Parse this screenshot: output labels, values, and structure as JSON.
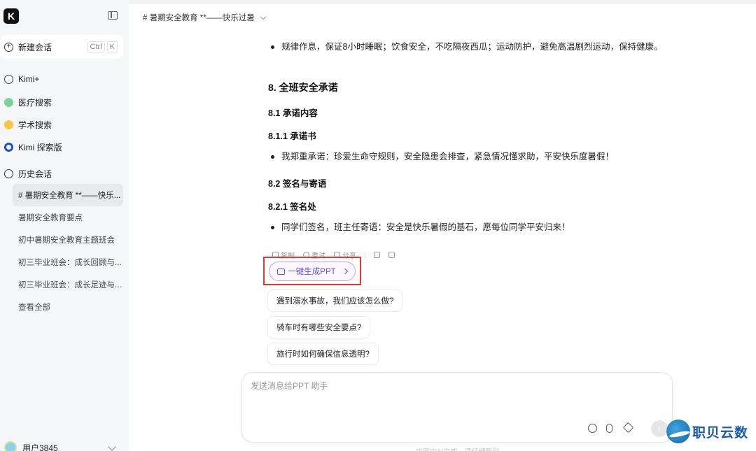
{
  "sidebar": {
    "logo": "K",
    "new_chat": {
      "label": "新建会话",
      "kbd_ctrl": "Ctrl",
      "kbd_key": "K"
    },
    "nav": [
      {
        "label": "Kimi+",
        "icon": "kimi-plus-icon"
      },
      {
        "label": "医疗搜索",
        "icon": "medical-search-icon"
      },
      {
        "label": "学术搜索",
        "icon": "academic-search-icon"
      },
      {
        "label": "Kimi 探索版",
        "icon": "kimi-explore-icon"
      }
    ],
    "history_label": "历史会话",
    "history": [
      "# 暑期安全教育 **——快乐...",
      "暑期安全教育要点",
      "初中暑期安全教育主题班会",
      "初三毕业班会：成长回顾与...",
      "初三毕业班会：成长足迹与..."
    ],
    "view_all": "查看全部",
    "user": "用户3845"
  },
  "main": {
    "title": "# 暑期安全教育 **——快乐过暑",
    "content": {
      "bullet1": "规律作息，保证8小时睡眠；饮食安全，不吃隔夜西瓜；运动防护，避免高温剧烈运动，保持健康。",
      "h_8": "8. 全班安全承诺",
      "h_8_1": "8.1 承诺内容",
      "h_8_1_1": "8.1.1 承诺书",
      "bullet2": "我郑重承诺：珍爱生命守规则，安全隐患会排查，紧急情况懂求助，平安快乐度暑假！",
      "h_8_2": "8.2 签名与寄语",
      "h_8_2_1": "8.2.1 签名处",
      "bullet3": "同学们签名，班主任寄语：安全是快乐暑假的基石，愿每位同学平安归来！"
    },
    "actions": {
      "copy": "复制",
      "retry": "重试",
      "share": "分享"
    },
    "ppt_button": "一键生成PPT",
    "suggestions": [
      "遇到溺水事故，我们应该怎么做?",
      "骑车时有哪些安全要点?",
      "旅行时如何确保信息透明?"
    ],
    "input_placeholder": "发送消息给PPT 助手",
    "footer_note": "内容由AI生成，请仔细甄别"
  },
  "watermark": "职贝云数"
}
